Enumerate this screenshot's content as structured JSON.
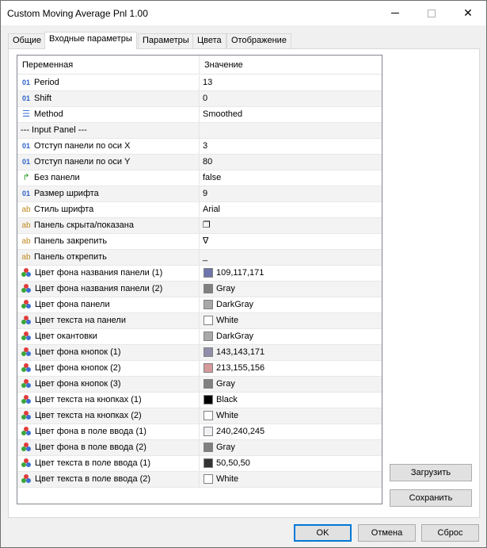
{
  "window": {
    "title": "Custom Moving Average Pnl 1.00",
    "minimize_glyph": "—",
    "maximize_glyph": "☐",
    "close_glyph": "✕"
  },
  "tabs": [
    {
      "label": "Общие",
      "active": false
    },
    {
      "label": "Входные параметры",
      "active": true
    },
    {
      "label": "Параметры",
      "active": false
    },
    {
      "label": "Цвета",
      "active": false
    },
    {
      "label": "Отображение",
      "active": false
    }
  ],
  "grid": {
    "header": {
      "variable": "Переменная",
      "value": "Значение"
    },
    "rows": [
      {
        "icon": "number-icon",
        "icon_glyph": "01",
        "name": "Period",
        "value": "13"
      },
      {
        "icon": "number-icon",
        "icon_glyph": "01",
        "name": "Shift",
        "value": "0"
      },
      {
        "icon": "list-icon",
        "icon_glyph": "☰",
        "name": "Method",
        "value": "Smoothed"
      },
      {
        "icon": "",
        "icon_glyph": "",
        "name": "--- Input Panel ---",
        "value": "",
        "section": true
      },
      {
        "icon": "number-icon",
        "icon_glyph": "01",
        "name": "Отступ панели по оси X",
        "value": "3"
      },
      {
        "icon": "number-icon",
        "icon_glyph": "01",
        "name": "Отступ панели по оси Y",
        "value": "80"
      },
      {
        "icon": "boolean-icon",
        "icon_glyph": "↱",
        "name": "Без панели",
        "value": "false"
      },
      {
        "icon": "number-icon",
        "icon_glyph": "01",
        "name": "Размер шрифта",
        "value": "9"
      },
      {
        "icon": "string-icon",
        "icon_glyph": "ab",
        "name": "Стиль шрифта",
        "value": "Arial"
      },
      {
        "icon": "string-icon",
        "icon_glyph": "ab",
        "name": "Панель скрыта/показана",
        "value": "❐"
      },
      {
        "icon": "string-icon",
        "icon_glyph": "ab",
        "name": "Панель закрепить",
        "value": "∇"
      },
      {
        "icon": "string-icon",
        "icon_glyph": "ab",
        "name": "Панель открепить",
        "value": "_"
      },
      {
        "icon": "color-icon",
        "name": "Цвет фона названия панели (1)",
        "value": "109,117,171",
        "swatch": "#6d75ab"
      },
      {
        "icon": "color-icon",
        "name": "Цвет фона названия панели (2)",
        "value": "Gray",
        "swatch": "#808080"
      },
      {
        "icon": "color-icon",
        "name": "Цвет фона панели",
        "value": "DarkGray",
        "swatch": "#a9a9a9"
      },
      {
        "icon": "color-icon",
        "name": "Цвет текста на панели",
        "value": "White",
        "swatch": "#ffffff"
      },
      {
        "icon": "color-icon",
        "name": "Цвет окантовки",
        "value": "DarkGray",
        "swatch": "#a9a9a9"
      },
      {
        "icon": "color-icon",
        "name": "Цвет фона кнопок (1)",
        "value": "143,143,171",
        "swatch": "#8f8fab"
      },
      {
        "icon": "color-icon",
        "name": "Цвет фона кнопок (2)",
        "value": "213,155,156",
        "swatch": "#d59b9c"
      },
      {
        "icon": "color-icon",
        "name": "Цвет фона кнопок (3)",
        "value": "Gray",
        "swatch": "#808080"
      },
      {
        "icon": "color-icon",
        "name": "Цвет текста на кнопках (1)",
        "value": "Black",
        "swatch": "#000000"
      },
      {
        "icon": "color-icon",
        "name": "Цвет текста на кнопках (2)",
        "value": "White",
        "swatch": "#ffffff"
      },
      {
        "icon": "color-icon",
        "name": "Цвет фона в поле ввода (1)",
        "value": "240,240,245",
        "swatch": "#f0f0f5"
      },
      {
        "icon": "color-icon",
        "name": "Цвет фона в поле ввода (2)",
        "value": "Gray",
        "swatch": "#808080"
      },
      {
        "icon": "color-icon",
        "name": "Цвет текста в поле ввода (1)",
        "value": "50,50,50",
        "swatch": "#323232"
      },
      {
        "icon": "color-icon",
        "name": "Цвет текста в поле ввода (2)",
        "value": "White",
        "swatch": "#ffffff"
      }
    ]
  },
  "side_buttons": {
    "load": "Загрузить",
    "save": "Сохранить"
  },
  "footer": {
    "ok": "OK",
    "cancel": "Отмена",
    "reset": "Сброс"
  }
}
